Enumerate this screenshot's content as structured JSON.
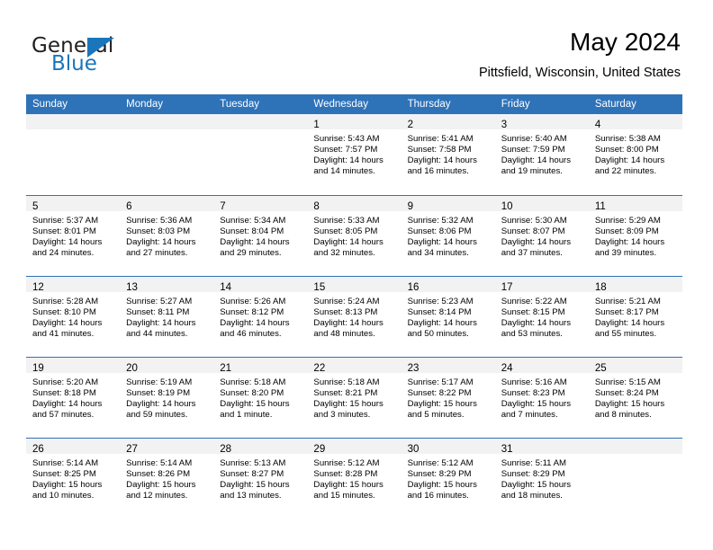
{
  "brand": {
    "word1": "General",
    "word2": "Blue",
    "logo_icon": "triangle-logo-icon",
    "accent_color": "#1b75bb"
  },
  "header": {
    "title": "May 2024",
    "location": "Pittsfield, Wisconsin, United States"
  },
  "theme": {
    "header_blue": "#2e72b8",
    "day_band_gray": "#f2f2f2"
  },
  "weekdays": [
    "Sunday",
    "Monday",
    "Tuesday",
    "Wednesday",
    "Thursday",
    "Friday",
    "Saturday"
  ],
  "labels": {
    "sunrise_prefix": "Sunrise:",
    "sunset_prefix": "Sunset:",
    "daylight_prefix": "Daylight:"
  },
  "weeks": [
    [
      {
        "empty": true
      },
      {
        "empty": true
      },
      {
        "empty": true
      },
      {
        "day": "1",
        "sunrise": "Sunrise: 5:43 AM",
        "sunset": "Sunset: 7:57 PM",
        "daylight1": "Daylight: 14 hours",
        "daylight2": "and 14 minutes."
      },
      {
        "day": "2",
        "sunrise": "Sunrise: 5:41 AM",
        "sunset": "Sunset: 7:58 PM",
        "daylight1": "Daylight: 14 hours",
        "daylight2": "and 16 minutes."
      },
      {
        "day": "3",
        "sunrise": "Sunrise: 5:40 AM",
        "sunset": "Sunset: 7:59 PM",
        "daylight1": "Daylight: 14 hours",
        "daylight2": "and 19 minutes."
      },
      {
        "day": "4",
        "sunrise": "Sunrise: 5:38 AM",
        "sunset": "Sunset: 8:00 PM",
        "daylight1": "Daylight: 14 hours",
        "daylight2": "and 22 minutes."
      }
    ],
    [
      {
        "day": "5",
        "sunrise": "Sunrise: 5:37 AM",
        "sunset": "Sunset: 8:01 PM",
        "daylight1": "Daylight: 14 hours",
        "daylight2": "and 24 minutes."
      },
      {
        "day": "6",
        "sunrise": "Sunrise: 5:36 AM",
        "sunset": "Sunset: 8:03 PM",
        "daylight1": "Daylight: 14 hours",
        "daylight2": "and 27 minutes."
      },
      {
        "day": "7",
        "sunrise": "Sunrise: 5:34 AM",
        "sunset": "Sunset: 8:04 PM",
        "daylight1": "Daylight: 14 hours",
        "daylight2": "and 29 minutes."
      },
      {
        "day": "8",
        "sunrise": "Sunrise: 5:33 AM",
        "sunset": "Sunset: 8:05 PM",
        "daylight1": "Daylight: 14 hours",
        "daylight2": "and 32 minutes."
      },
      {
        "day": "9",
        "sunrise": "Sunrise: 5:32 AM",
        "sunset": "Sunset: 8:06 PM",
        "daylight1": "Daylight: 14 hours",
        "daylight2": "and 34 minutes."
      },
      {
        "day": "10",
        "sunrise": "Sunrise: 5:30 AM",
        "sunset": "Sunset: 8:07 PM",
        "daylight1": "Daylight: 14 hours",
        "daylight2": "and 37 minutes."
      },
      {
        "day": "11",
        "sunrise": "Sunrise: 5:29 AM",
        "sunset": "Sunset: 8:09 PM",
        "daylight1": "Daylight: 14 hours",
        "daylight2": "and 39 minutes."
      }
    ],
    [
      {
        "day": "12",
        "sunrise": "Sunrise: 5:28 AM",
        "sunset": "Sunset: 8:10 PM",
        "daylight1": "Daylight: 14 hours",
        "daylight2": "and 41 minutes."
      },
      {
        "day": "13",
        "sunrise": "Sunrise: 5:27 AM",
        "sunset": "Sunset: 8:11 PM",
        "daylight1": "Daylight: 14 hours",
        "daylight2": "and 44 minutes."
      },
      {
        "day": "14",
        "sunrise": "Sunrise: 5:26 AM",
        "sunset": "Sunset: 8:12 PM",
        "daylight1": "Daylight: 14 hours",
        "daylight2": "and 46 minutes."
      },
      {
        "day": "15",
        "sunrise": "Sunrise: 5:24 AM",
        "sunset": "Sunset: 8:13 PM",
        "daylight1": "Daylight: 14 hours",
        "daylight2": "and 48 minutes."
      },
      {
        "day": "16",
        "sunrise": "Sunrise: 5:23 AM",
        "sunset": "Sunset: 8:14 PM",
        "daylight1": "Daylight: 14 hours",
        "daylight2": "and 50 minutes."
      },
      {
        "day": "17",
        "sunrise": "Sunrise: 5:22 AM",
        "sunset": "Sunset: 8:15 PM",
        "daylight1": "Daylight: 14 hours",
        "daylight2": "and 53 minutes."
      },
      {
        "day": "18",
        "sunrise": "Sunrise: 5:21 AM",
        "sunset": "Sunset: 8:17 PM",
        "daylight1": "Daylight: 14 hours",
        "daylight2": "and 55 minutes."
      }
    ],
    [
      {
        "day": "19",
        "sunrise": "Sunrise: 5:20 AM",
        "sunset": "Sunset: 8:18 PM",
        "daylight1": "Daylight: 14 hours",
        "daylight2": "and 57 minutes."
      },
      {
        "day": "20",
        "sunrise": "Sunrise: 5:19 AM",
        "sunset": "Sunset: 8:19 PM",
        "daylight1": "Daylight: 14 hours",
        "daylight2": "and 59 minutes."
      },
      {
        "day": "21",
        "sunrise": "Sunrise: 5:18 AM",
        "sunset": "Sunset: 8:20 PM",
        "daylight1": "Daylight: 15 hours",
        "daylight2": "and 1 minute."
      },
      {
        "day": "22",
        "sunrise": "Sunrise: 5:18 AM",
        "sunset": "Sunset: 8:21 PM",
        "daylight1": "Daylight: 15 hours",
        "daylight2": "and 3 minutes."
      },
      {
        "day": "23",
        "sunrise": "Sunrise: 5:17 AM",
        "sunset": "Sunset: 8:22 PM",
        "daylight1": "Daylight: 15 hours",
        "daylight2": "and 5 minutes."
      },
      {
        "day": "24",
        "sunrise": "Sunrise: 5:16 AM",
        "sunset": "Sunset: 8:23 PM",
        "daylight1": "Daylight: 15 hours",
        "daylight2": "and 7 minutes."
      },
      {
        "day": "25",
        "sunrise": "Sunrise: 5:15 AM",
        "sunset": "Sunset: 8:24 PM",
        "daylight1": "Daylight: 15 hours",
        "daylight2": "and 8 minutes."
      }
    ],
    [
      {
        "day": "26",
        "sunrise": "Sunrise: 5:14 AM",
        "sunset": "Sunset: 8:25 PM",
        "daylight1": "Daylight: 15 hours",
        "daylight2": "and 10 minutes."
      },
      {
        "day": "27",
        "sunrise": "Sunrise: 5:14 AM",
        "sunset": "Sunset: 8:26 PM",
        "daylight1": "Daylight: 15 hours",
        "daylight2": "and 12 minutes."
      },
      {
        "day": "28",
        "sunrise": "Sunrise: 5:13 AM",
        "sunset": "Sunset: 8:27 PM",
        "daylight1": "Daylight: 15 hours",
        "daylight2": "and 13 minutes."
      },
      {
        "day": "29",
        "sunrise": "Sunrise: 5:12 AM",
        "sunset": "Sunset: 8:28 PM",
        "daylight1": "Daylight: 15 hours",
        "daylight2": "and 15 minutes."
      },
      {
        "day": "30",
        "sunrise": "Sunrise: 5:12 AM",
        "sunset": "Sunset: 8:29 PM",
        "daylight1": "Daylight: 15 hours",
        "daylight2": "and 16 minutes."
      },
      {
        "day": "31",
        "sunrise": "Sunrise: 5:11 AM",
        "sunset": "Sunset: 8:29 PM",
        "daylight1": "Daylight: 15 hours",
        "daylight2": "and 18 minutes."
      },
      {
        "empty": true
      }
    ]
  ]
}
